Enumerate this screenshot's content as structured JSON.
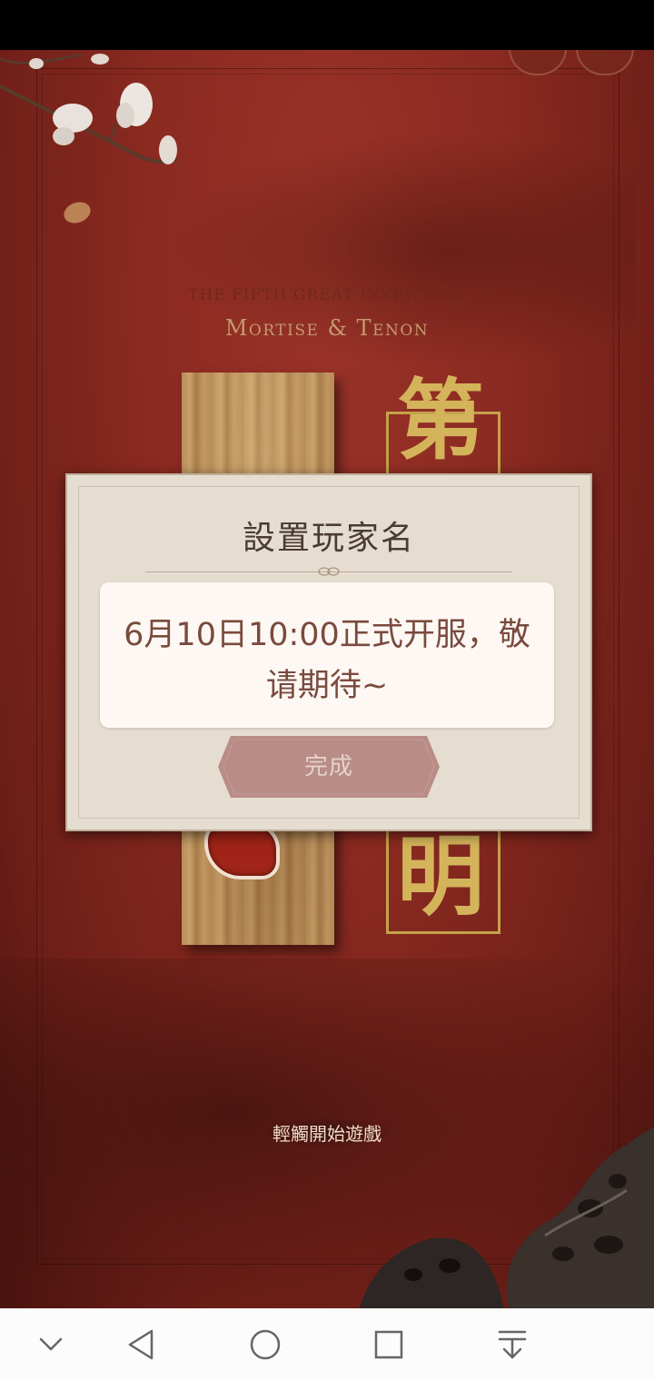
{
  "game": {
    "subtitle_en": "THE FIFTH GREAT INVENTION",
    "title_en": "Mortise & Tenon",
    "title_glyphs": [
      "第",
      "明"
    ],
    "start_prompt": "輕觸開始遊戲"
  },
  "dialog": {
    "title": "設置玩家名",
    "message": "6月10日10:00正式开服，敬请期待~",
    "done_button": "完成"
  },
  "colors": {
    "background_red": "#8a2a21",
    "gold": "#c4a24a",
    "dialog_bg": "#e6ddd1",
    "button_bg": "#b98c86"
  },
  "navbar": {
    "icons": [
      "chevron-down-icon",
      "back-triangle-icon",
      "home-circle-icon",
      "recents-square-icon",
      "notification-pull-icon"
    ]
  }
}
